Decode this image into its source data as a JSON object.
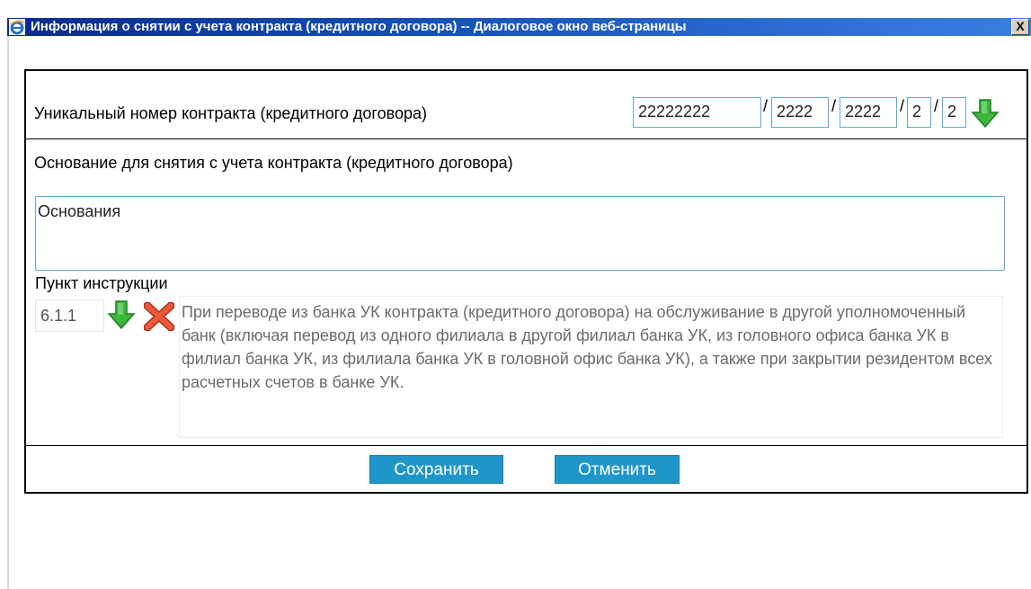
{
  "window": {
    "title": "Информация о снятии с учета контракта (кредитного договора) -- Диалоговое окно веб-страницы",
    "close_label": "X",
    "app_icon": "ie-icon"
  },
  "contract": {
    "label": "Уникальный номер контракта (кредитного договора)",
    "parts": [
      "22222222",
      "2222",
      "2222",
      "2",
      "2"
    ],
    "separator": "/",
    "pick_icon": "green-down-arrow-icon"
  },
  "basis": {
    "label": "Основание для снятия с учета контракта (кредитного договора)",
    "value": "Основания"
  },
  "instruction": {
    "label": "Пункт инструкции",
    "code": "6.1.1",
    "text": "При переводе из банка УК контракта (кредитного договора) на обслуживание в другой уполномоченный банк (включая перевод из одного филиала в другой филиал банка УК, из головного офиса банка УК в филиал банка УК, из филиала банка УК в головной офис банка УК), а также при закрытии резидентом всех расчетных счетов в банке УК.",
    "select_icon": "green-down-arrow-icon",
    "clear_icon": "red-x-icon"
  },
  "actions": {
    "save": "Сохранить",
    "cancel": "Отменить"
  },
  "colors": {
    "title_bar": "#0a2a8c",
    "input_border": "#5aa9d8",
    "button": "#1f96c9",
    "arrow": "#3cb83c",
    "delete": "#e0462a"
  }
}
